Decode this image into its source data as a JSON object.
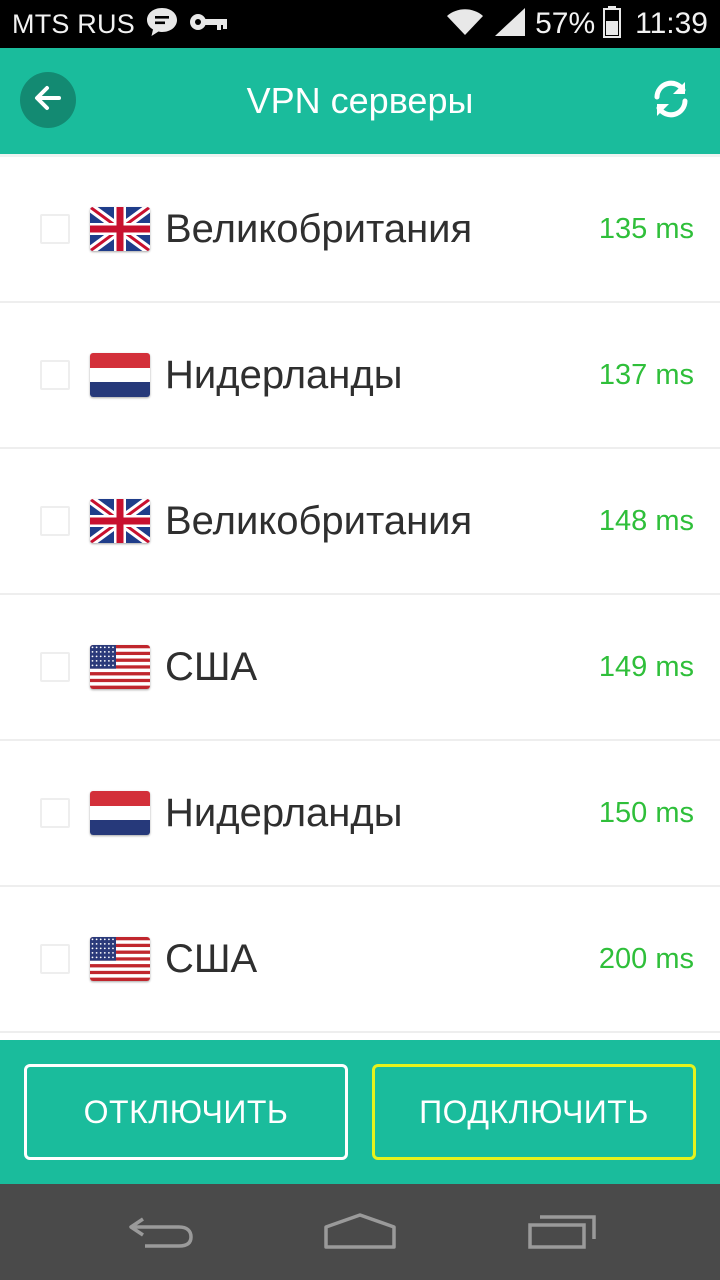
{
  "status_bar": {
    "carrier": "MTS RUS",
    "battery": "57%",
    "time": "11:39"
  },
  "app_bar": {
    "title": "VPN серверы"
  },
  "servers": [
    {
      "country": "Великобритания",
      "flag": "uk",
      "ping": "135 ms"
    },
    {
      "country": "Нидерланды",
      "flag": "nl",
      "ping": "137 ms"
    },
    {
      "country": "Великобритания",
      "flag": "uk",
      "ping": "148 ms"
    },
    {
      "country": "США",
      "flag": "us",
      "ping": "149 ms"
    },
    {
      "country": "Нидерланды",
      "flag": "nl",
      "ping": "150 ms"
    },
    {
      "country": "США",
      "flag": "us",
      "ping": "200 ms"
    }
  ],
  "actions": {
    "disconnect_label": "ОТКЛЮЧИТЬ",
    "connect_label": "ПОДКЛЮЧИТЬ"
  },
  "colors": {
    "primary": "#1abc9c",
    "primary_dark": "#138a72",
    "ping": "#2fbf3a",
    "connect_border": "#e6f21c"
  },
  "icons": {
    "status": [
      "message-icon",
      "key-icon",
      "wifi-icon",
      "signal-icon",
      "battery-icon"
    ],
    "app_bar": [
      "back-arrow-icon",
      "refresh-icon"
    ],
    "nav": [
      "nav-back-icon",
      "nav-home-icon",
      "nav-recent-icon"
    ]
  }
}
